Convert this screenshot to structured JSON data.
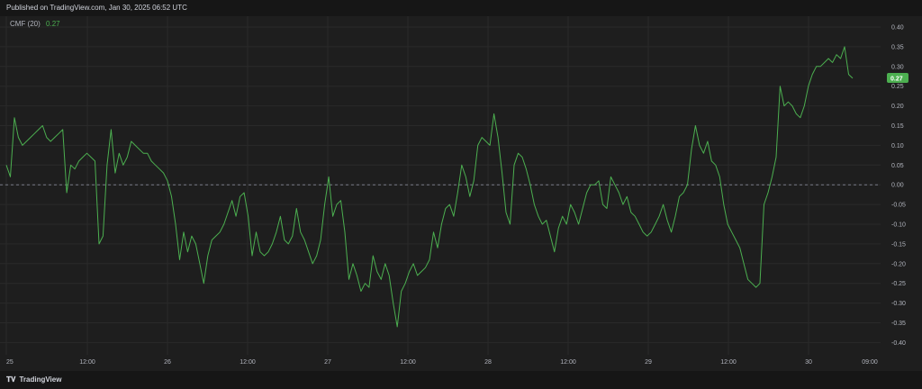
{
  "header": {
    "published": "Published on TradingView.com, Jan 30, 2025 06:52 UTC"
  },
  "legend": {
    "name": "CMF (20)",
    "value": "0.27"
  },
  "footer": {
    "logo_text": "TradingView",
    "logo_icon": "tradingview-logo-icon"
  },
  "colors": {
    "line": "#4caf50",
    "badge": "#4caf50",
    "zero_line": "#787b86",
    "grid": "#2a2a2a"
  },
  "chart_data": {
    "type": "line",
    "title": "",
    "indicator": "CMF (20)",
    "last_value": "0.27",
    "ylim": [
      -0.42,
      0.42
    ],
    "yticks": [
      "0.40",
      "0.35",
      "0.30",
      "0.25",
      "0.20",
      "0.15",
      "0.10",
      "0.05",
      "0.00",
      "-0.05",
      "-0.10",
      "-0.15",
      "-0.20",
      "-0.25",
      "-0.30",
      "-0.35",
      "-0.40"
    ],
    "xticks": [
      "25",
      "12:00",
      "26",
      "12:00",
      "27",
      "12:00",
      "28",
      "12:00",
      "29",
      "12:00",
      "30",
      "09:00"
    ],
    "zero_line": true,
    "grid": true,
    "series": [
      {
        "values": [
          0.05,
          0.02,
          0.17,
          0.12,
          0.1,
          0.11,
          0.12,
          0.13,
          0.14,
          0.15,
          0.12,
          0.11,
          0.12,
          0.13,
          0.14,
          -0.02,
          0.05,
          0.04,
          0.06,
          0.07,
          0.08,
          0.07,
          0.06,
          -0.15,
          -0.13,
          0.05,
          0.14,
          0.03,
          0.08,
          0.05,
          0.07,
          0.11,
          0.1,
          0.09,
          0.08,
          0.08,
          0.06,
          0.05,
          0.04,
          0.03,
          0.01,
          -0.03,
          -0.1,
          -0.19,
          -0.12,
          -0.17,
          -0.13,
          -0.15,
          -0.2,
          -0.25,
          -0.18,
          -0.14,
          -0.13,
          -0.12,
          -0.1,
          -0.07,
          -0.04,
          -0.08,
          -0.03,
          -0.02,
          -0.08,
          -0.18,
          -0.12,
          -0.17,
          -0.18,
          -0.17,
          -0.15,
          -0.12,
          -0.08,
          -0.14,
          -0.15,
          -0.13,
          -0.06,
          -0.12,
          -0.14,
          -0.17,
          -0.2,
          -0.18,
          -0.14,
          -0.05,
          0.02,
          -0.08,
          -0.05,
          -0.04,
          -0.12,
          -0.24,
          -0.2,
          -0.23,
          -0.27,
          -0.25,
          -0.26,
          -0.18,
          -0.22,
          -0.24,
          -0.2,
          -0.23,
          -0.3,
          -0.36,
          -0.27,
          -0.25,
          -0.22,
          -0.2,
          -0.23,
          -0.22,
          -0.21,
          -0.19,
          -0.12,
          -0.16,
          -0.1,
          -0.06,
          -0.05,
          -0.08,
          -0.02,
          0.05,
          0.02,
          -0.03,
          0.01,
          0.1,
          0.12,
          0.11,
          0.1,
          0.18,
          0.12,
          0.03,
          -0.07,
          -0.1,
          0.05,
          0.08,
          0.07,
          0.04,
          0.0,
          -0.05,
          -0.08,
          -0.1,
          -0.09,
          -0.13,
          -0.17,
          -0.11,
          -0.08,
          -0.1,
          -0.05,
          -0.07,
          -0.1,
          -0.06,
          -0.02,
          0.0,
          0.0,
          0.01,
          -0.05,
          -0.06,
          0.02,
          0.0,
          -0.02,
          -0.05,
          -0.03,
          -0.07,
          -0.08,
          -0.1,
          -0.12,
          -0.13,
          -0.12,
          -0.1,
          -0.08,
          -0.05,
          -0.09,
          -0.12,
          -0.08,
          -0.03,
          -0.02,
          0.0,
          0.09,
          0.15,
          0.1,
          0.08,
          0.11,
          0.06,
          0.05,
          0.02,
          -0.05,
          -0.1,
          -0.12,
          -0.14,
          -0.16,
          -0.2,
          -0.24,
          -0.25,
          -0.26,
          -0.25,
          -0.05,
          -0.02,
          0.02,
          0.07,
          0.25,
          0.2,
          0.21,
          0.2,
          0.18,
          0.17,
          0.2,
          0.25,
          0.28,
          0.3,
          0.3,
          0.31,
          0.32,
          0.31,
          0.33,
          0.32,
          0.35,
          0.28,
          0.27
        ]
      }
    ]
  }
}
